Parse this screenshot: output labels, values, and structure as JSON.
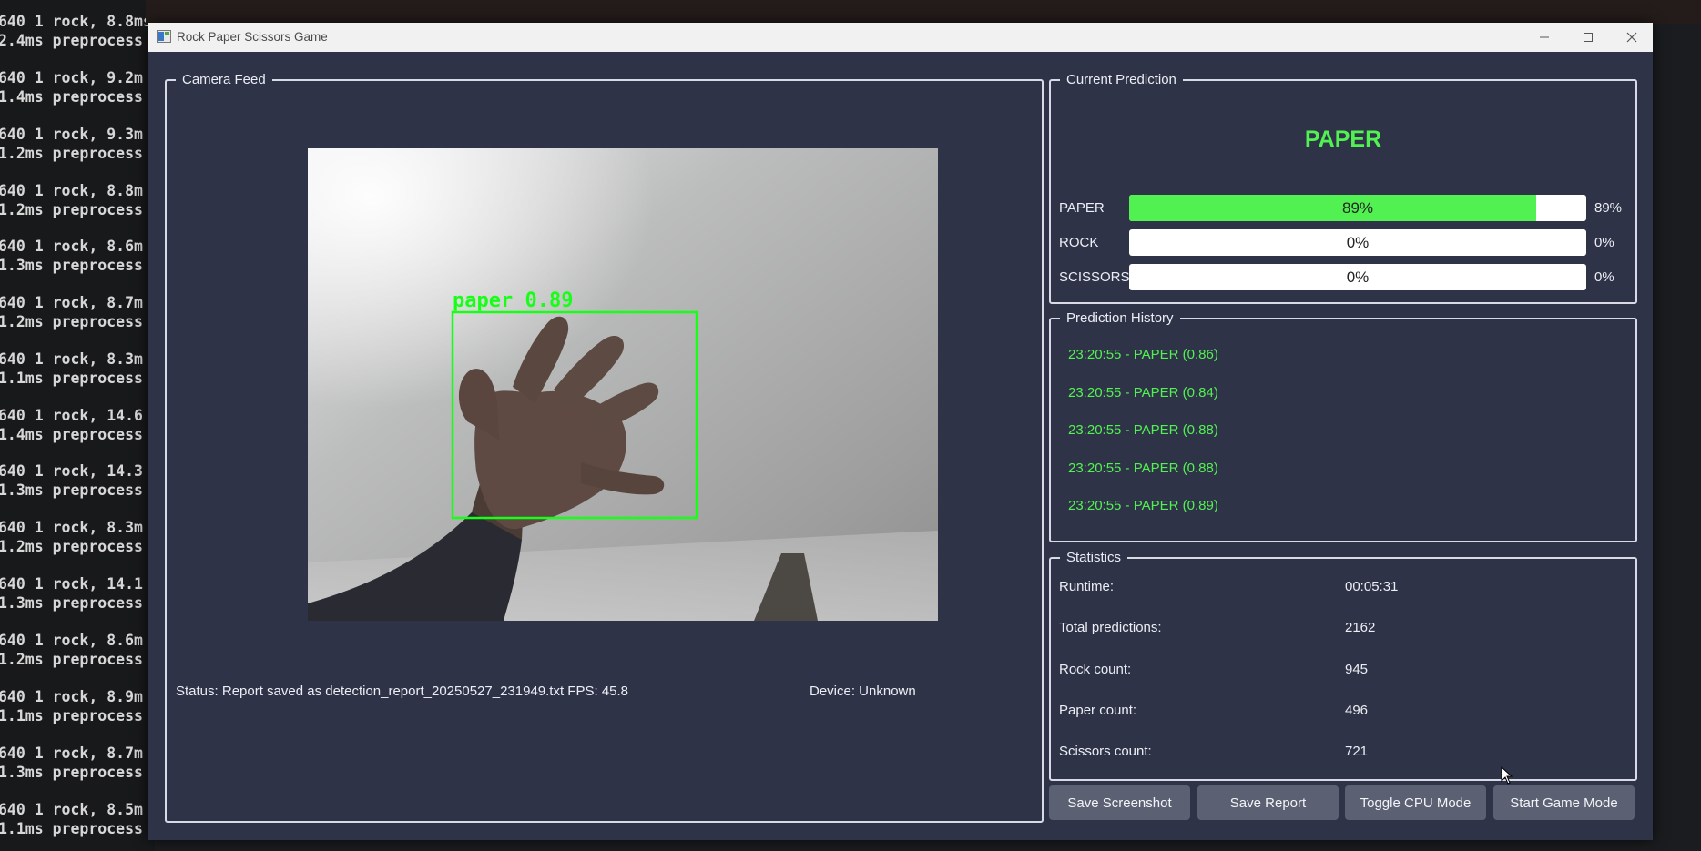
{
  "terminal": {
    "lines": [
      "640 1 rock, 8.8ms",
      "2.4ms preprocess",
      "640 1 rock, 9.2m",
      "1.4ms preprocess",
      "640 1 rock, 9.3m",
      "1.2ms preprocess",
      "640 1 rock, 8.8m",
      "1.2ms preprocess",
      "640 1 rock, 8.6m",
      "1.3ms preprocess",
      "640 1 rock, 8.7m",
      "1.2ms preprocess",
      "640 1 rock, 8.3m",
      "1.1ms preprocess",
      "640 1 rock, 14.6",
      "1.4ms preprocess",
      "640 1 rock, 14.3",
      "1.3ms preprocess",
      "640 1 rock, 8.3m",
      "1.2ms preprocess",
      "640 1 rock, 14.1",
      "1.3ms preprocess",
      "640 1 rock, 8.6m",
      "1.2ms preprocess",
      "640 1 rock, 8.9m",
      "1.1ms preprocess",
      "640 1 rock, 8.7m",
      "1.3ms preprocess",
      "640 1 rock, 8.5m",
      "1.1ms preprocess"
    ]
  },
  "window": {
    "title": "Rock Paper Scissors Game"
  },
  "camera": {
    "group_title": "Camera Feed",
    "detection_label": "paper 0.89",
    "status_text": "Status: Report saved as detection_report_20250527_231949.txt  FPS: 45.8",
    "device_text": "Device: Unknown"
  },
  "prediction": {
    "group_title": "Current Prediction",
    "current": "PAPER",
    "rows": [
      {
        "label": "PAPER",
        "bar_text": "89%",
        "value_text": "89%",
        "fraction": 0.89
      },
      {
        "label": "ROCK",
        "bar_text": "0%",
        "value_text": "0%",
        "fraction": 0.0
      },
      {
        "label": "SCISSORS",
        "bar_text": "0%",
        "value_text": "0%",
        "fraction": 0.0
      }
    ]
  },
  "history": {
    "group_title": "Prediction History",
    "items": [
      "23:20:55 - PAPER (0.86)",
      "23:20:55 - PAPER (0.84)",
      "23:20:55 - PAPER (0.88)",
      "23:20:55 - PAPER (0.88)",
      "23:20:55 - PAPER (0.89)"
    ]
  },
  "statistics": {
    "group_title": "Statistics",
    "rows": [
      {
        "label": "Runtime:",
        "value": "00:05:31"
      },
      {
        "label": "Total predictions:",
        "value": "2162"
      },
      {
        "label": "Rock count:",
        "value": "945"
      },
      {
        "label": "Paper count:",
        "value": "496"
      },
      {
        "label": "Scissors count:",
        "value": "721"
      }
    ]
  },
  "buttons": {
    "save_screenshot": "Save Screenshot",
    "save_report": "Save Report",
    "toggle_cpu": "Toggle CPU Mode",
    "start_game": "Start Game Mode"
  },
  "colors": {
    "window_bg": "#2f3347",
    "accent_green": "#52f152",
    "button_bg": "#5b6173"
  }
}
